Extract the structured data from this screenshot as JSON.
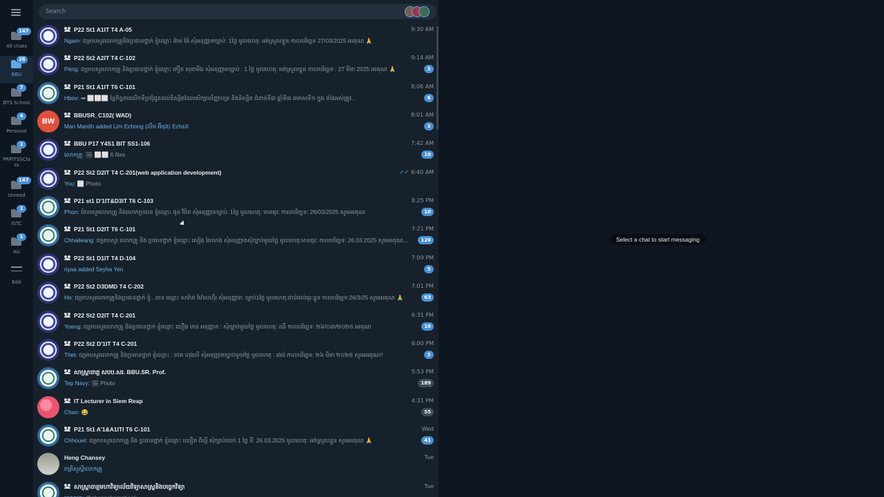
{
  "search": {
    "placeholder": "Search"
  },
  "folders": [
    {
      "label": "All chats",
      "badge": "147",
      "active": false
    },
    {
      "label": "BBU",
      "badge": "26",
      "active": true
    },
    {
      "label": "BTS School",
      "badge": "7",
      "active": false
    },
    {
      "label": "Personal",
      "badge": "4",
      "active": false
    },
    {
      "label": "PRPITSSCla ss",
      "badge": "1",
      "active": false
    },
    {
      "label": "Unread",
      "badge": "147",
      "active": false
    },
    {
      "label": "ISTC",
      "badge": "1",
      "active": false
    },
    {
      "label": "AU",
      "badge": "1",
      "active": false
    }
  ],
  "edit_label": "Edit",
  "chats": [
    {
      "title": "P22 St1 A1IT T4 A-05",
      "time": "9:30 AM",
      "sender": "Ngam:",
      "text": " ជម្រាបសួរលោកគ្រូនិងប្រធានថ្នាក់ ខ្ញុំឈ្មោះ ង៉ាម ង៉ៃ សុំអនុញ្ញាតច្បាប់: 1ថ្ងៃ មូលហេតុ: អត់ស្រួលខ្លួន កាលបរិច្ឆេទ 27/03/2025 អរគុណ 🙏",
      "unread": ""
    },
    {
      "title": "P22 St2 A2IT T4 C-102",
      "time": "9:14 AM",
      "sender": "Péng:",
      "text": " ជម្រាបសួរលោកគ្រូ និងប្រធានថ្នាក់ ខ្ញុំឈ្មោះ ភឿន សុខាមីង សុំអនុញ្ញាតច្បាប់ : 1 ថ្ងៃ មូលហេតុ: អត់ស្រួលខ្លួន កាលបរិច្ឆេទ : 27 មីនា 2025 អរគុណ 🙏",
      "unread": "3"
    },
    {
      "title": "P21 St1 A1IT T6 C-101",
      "time": "8:06 AM",
      "sender": "Hbov:",
      "text": " ➡ ⬜⬜⬜ នៃ្តកិច្ចការលើកទីប្រជុំជូនដល់និស្សិតដែលសិក្សាបរិញ្ញាបត្រ និងនិស្សិត ជំនាន់ទី៣ ឆ្នាំទី៣ ឆមាសទី១ ក្នុង ទាំងអស់ត្រូវ...",
      "unread": "6"
    },
    {
      "title": "BBUSR_C102( WAD)",
      "time": "8:01 AM",
      "sender": "",
      "text": "Man Manith added Lim Echong (លឹម អ៊ីចុង) EchsX",
      "unread": "3",
      "avatar": "BW"
    },
    {
      "title": "BBU P17 Y4S1 BIT SS1-106",
      "time": "7:42 AM",
      "sender": "លោកគ្រូ:",
      "text": " 🖼 ⬜⬜ 6 files",
      "unread": "10"
    },
    {
      "title": "P22 St2 D2IT T4 C-201(web application development)",
      "time": "6:40 AM",
      "sender": "You:",
      "text": " ⬜ Photo",
      "unread": ""
    },
    {
      "title": "P21 st1 D'1IT&D3IT T6 C-103",
      "time": "8:25 PM",
      "sender": "Phon:",
      "text": " ជំរាបសួរលោកគ្រូ និងលោកប្រធាន ខ្ញុំឈ្មោះ ផុន វិចិត  សុំអនុញ្ញាតច្បាប់: 1ថ្ងៃ មូលហេតុ: មានធុរៈ កាលបរិច្ឆេទ: 26/03/2025 សូមអរគុណ",
      "unread": "10"
    },
    {
      "title": "P21 St1 D2IT T6 C-101",
      "time": "7:21 PM",
      "sender": "Chhaileang:",
      "text": " ជម្រាបសួរ លោកគ្រូ និង ប្រធានថ្នាក់  ខ្ញុំឈ្មោះ សៀង ឆៃលាង សុំអនុញ្ញាតសុំច្បាប់មួយថ្ងៃ មូលហេតុ:មានធុរៈ កាលបរិច្ឆេទ: 26.03.2025 សូមអរគុណ...",
      "unread": "126"
    },
    {
      "title": "P22 St1 D1IT T4 D-104",
      "time": "7:09 PM",
      "sender": "",
      "text": "riyaa added Seyha Yen",
      "unread": "5"
    },
    {
      "title": "P22 St2 D3DMD T4 C-202",
      "time": "7:01 PM",
      "sender": "Ho:",
      "text": " ជម្រាបសួរលោកគ្រូនិងប្រធានថ្នាក់ ខ្ញុំ...បាទ ឈ្មោះ សាវ៉ាត់ ហ៊ែលហ៊ីរ សុំអនុញ្ញាត: ច្បាប់1ថ្ងៃ មូលហេតុ:ជាប់រវល់ធុរៈខ្លួន កាលបរិច្ឆេទ:26/3/25 សូមអរគុណ 🙏",
      "unread": "63"
    },
    {
      "title": "P22 St2 D2IT T4 C-201",
      "time": "6:31 PM",
      "sender": "Yoeng:",
      "text": " ជម្រាបសួរលោកគ្រូ និងប្រធានថ្នាក់ ខ្ញុំឈ្មោះ យឿង មាន អនុញ្ញាត : សុំច្បាប់មួយថ្ងៃ មូលហេតុ: ឈឺ កាលបរិច្ឆេទ: ២៦/០៣/២០២៥ អរគុណ",
      "unread": "16"
    },
    {
      "title": "P22 St2 D'1IT T4 C-201",
      "time": "6:00 PM",
      "sender": "Thet:",
      "text": " ជម្រាបសួរលោកគ្រូ និងប្រធានថ្នាក់ ខ្ញុំឈ្មោះ : ថេត ហុងលី សុំអនុញ្ញាតច្បាប់មួយថ្ងៃ  មូលហេតុ : រវល់ កាលបរិច្ឆេទ: ២៦ មីនា ២០២៥ សូមអរគុណ!!",
      "unread": "3"
    },
    {
      "title": "សាស្ត្រាចារ្យ សបប.សរ. BBU.SR. Prof.",
      "time": "5:53 PM",
      "sender": "Tep Navy:",
      "text": " 🖼 Photo",
      "unread": "189",
      "muted": true
    },
    {
      "title": "IT Lecturer in Siem Reap",
      "time": "4:31 PM",
      "sender": "Chan:",
      "text": " 😂",
      "unread": "55",
      "muted": true
    },
    {
      "title": "P21 St1 A'1&A1ITI T6 C-101",
      "time": "Wed",
      "sender": "Chhouet:",
      "text": " ជម្រាបសួរលោកគ្រូ និង ប្រធានថ្នាក់ ខ្ញុំឈ្មោះ ឈឿត ពីលី្ញ សុំច្បាប់ឈប់ 1 ថ្ងៃ ទី: 26.03.2025 មូលហេតុ: អត់ស្រួលខ្លួន សូមអរគុណ 🙏",
      "unread": "41"
    },
    {
      "title": "Heng Chansey",
      "time": "Tue",
      "sender": "",
      "text": "រាត្រីសួស្តីលោកគ្រូ",
      "unread": "",
      "group": false
    },
    {
      "title": "សាស្ត្រាចារ្យមហាវិទ្យាល័យវិទ្យាសាស្ត្រនិងបច្ចេកវិទ្យា",
      "time": "Tue",
      "sender": "លោកគ្រូ:",
      "text": " @phanngkompheak",
      "unread": ""
    }
  ],
  "main": {
    "empty_message": "Select a chat to start messaging"
  }
}
